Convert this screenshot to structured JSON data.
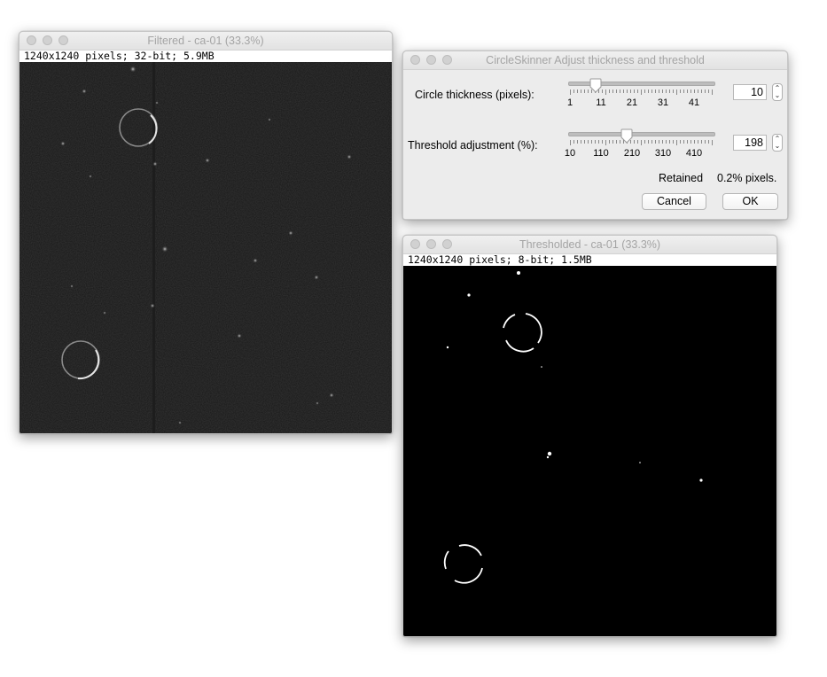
{
  "filtered_window": {
    "title": "Filtered - ca-01 (33.3%)",
    "info": "1240x1240 pixels; 32-bit; 5.9MB"
  },
  "dialog": {
    "title": "CircleSkinner Adjust thickness and threshold",
    "thickness": {
      "label": "Circle thickness (pixels):",
      "value": "10",
      "slider_fraction": 0.19,
      "ticks": [
        "1",
        "11",
        "21",
        "31",
        "41"
      ]
    },
    "threshold": {
      "label": "Threshold adjustment (%):",
      "value": "198",
      "slider_fraction": 0.4,
      "ticks": [
        "10",
        "110",
        "210",
        "310",
        "410"
      ]
    },
    "retained_label": "Retained",
    "retained_value": "0.2% pixels.",
    "cancel_label": "Cancel",
    "ok_label": "OK"
  },
  "thresholded_window": {
    "title": "Thresholded - ca-01 (33.3%)",
    "info": "1240x1240 pixels; 8-bit; 1.5MB"
  },
  "colors": {
    "window_bg": "#ececec",
    "title_text": "#a4a4a4",
    "image_bg_filtered": "#161616",
    "image_bg_thresholded": "#000000"
  }
}
